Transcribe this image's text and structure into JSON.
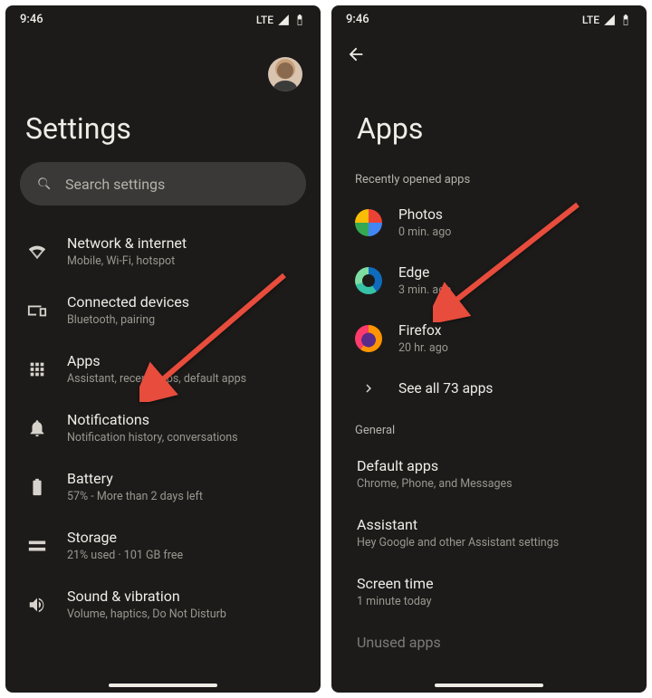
{
  "status": {
    "time": "9:46",
    "network": "LTE"
  },
  "left": {
    "title": "Settings",
    "search_placeholder": "Search settings",
    "items": [
      {
        "icon": "wifi",
        "label": "Network & internet",
        "sub": "Mobile, Wi-Fi, hotspot"
      },
      {
        "icon": "devices",
        "label": "Connected devices",
        "sub": "Bluetooth, pairing"
      },
      {
        "icon": "apps",
        "label": "Apps",
        "sub": "Assistant, recent apps, default apps"
      },
      {
        "icon": "bell",
        "label": "Notifications",
        "sub": "Notification history, conversations"
      },
      {
        "icon": "battery",
        "label": "Battery",
        "sub": "57% - More than 2 days left"
      },
      {
        "icon": "storage",
        "label": "Storage",
        "sub": "21% used · 101 GB free"
      },
      {
        "icon": "sound",
        "label": "Sound & vibration",
        "sub": "Volume, haptics, Do Not Disturb"
      }
    ]
  },
  "right": {
    "title": "Apps",
    "recent_header": "Recently opened apps",
    "recent": [
      {
        "icon": "photos",
        "label": "Photos",
        "sub": "0 min. ago"
      },
      {
        "icon": "edge",
        "label": "Edge",
        "sub": "3 min. ago"
      },
      {
        "icon": "firefox",
        "label": "Firefox",
        "sub": "20 hr. ago"
      }
    ],
    "see_all": "See all 73 apps",
    "general_header": "General",
    "general": [
      {
        "label": "Default apps",
        "sub": "Chrome, Phone, and Messages"
      },
      {
        "label": "Assistant",
        "sub": "Hey Google and other Assistant settings"
      },
      {
        "label": "Screen time",
        "sub": "1 minute today"
      }
    ],
    "cutoff_label": "Unused apps"
  }
}
